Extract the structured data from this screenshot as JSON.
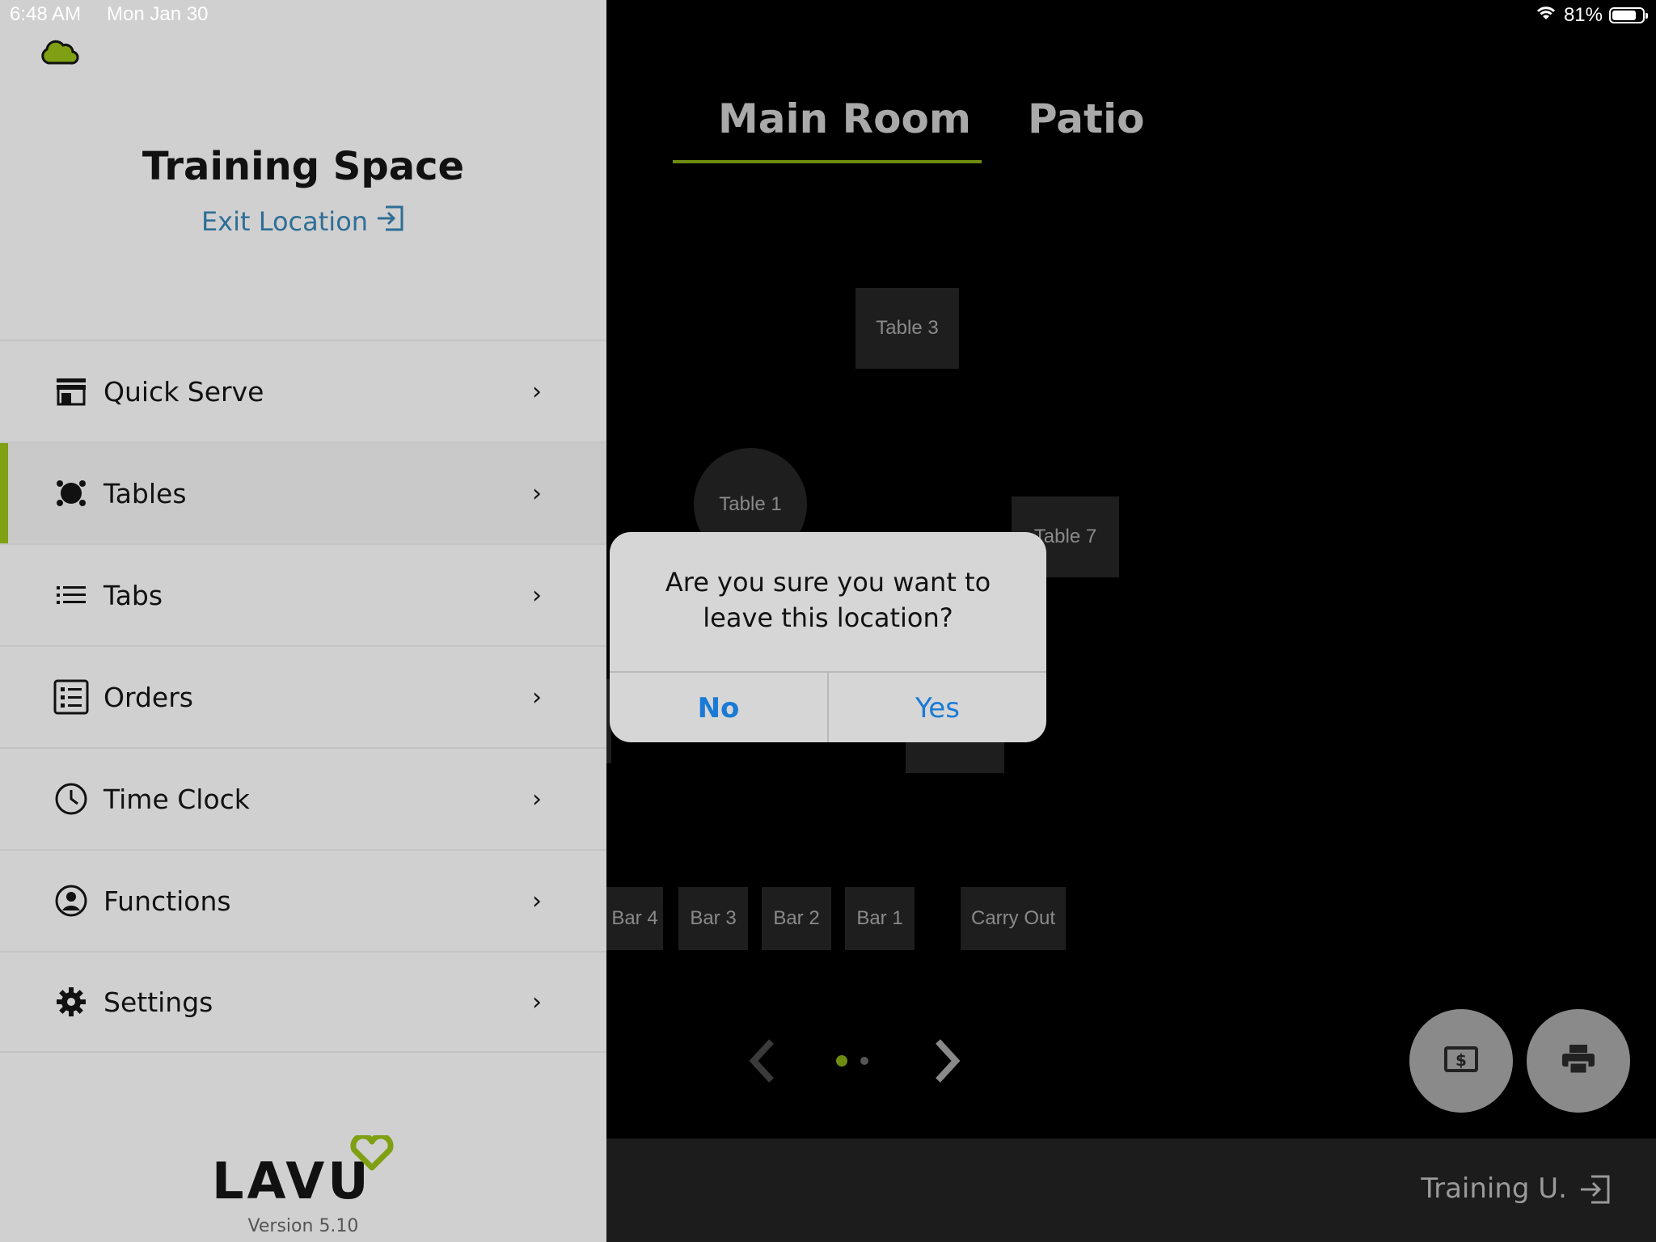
{
  "status_bar": {
    "time": "6:48 AM",
    "date": "Mon Jan 30",
    "battery": "81%",
    "battery_level": 0.81
  },
  "sidebar": {
    "title": "Training Space",
    "exit_location": "Exit Location",
    "items": [
      {
        "label": "Quick Serve",
        "icon": "store-icon"
      },
      {
        "label": "Tables",
        "icon": "tables-icon",
        "active": true
      },
      {
        "label": "Tabs",
        "icon": "list-icon"
      },
      {
        "label": "Orders",
        "icon": "orders-icon"
      },
      {
        "label": "Time Clock",
        "icon": "clock-icon"
      },
      {
        "label": "Functions",
        "icon": "user-circle-icon"
      },
      {
        "label": "Settings",
        "icon": "gear-icon"
      }
    ],
    "logo_text": "LAVU",
    "version": "Version 5.10"
  },
  "rooms": {
    "tabs": [
      "Main Room",
      "Patio"
    ],
    "active": "Main Room"
  },
  "tables": [
    {
      "label": "Table 3"
    },
    {
      "label": "Table 1"
    },
    {
      "label": "Table 7"
    },
    {
      "label": "Bar 4"
    },
    {
      "label": "Bar 3"
    },
    {
      "label": "Bar 2"
    },
    {
      "label": "Bar 1"
    },
    {
      "label": "Carry Out"
    }
  ],
  "pager": {
    "current": 1,
    "total": 2
  },
  "footer": {
    "user": "Training U."
  },
  "dialog": {
    "message": "Are you sure you want to leave this location?",
    "no": "No",
    "yes": "Yes"
  },
  "colors": {
    "accent": "#7fa012",
    "link": "#2e6e96",
    "dialog_button": "#1a7ad6"
  }
}
